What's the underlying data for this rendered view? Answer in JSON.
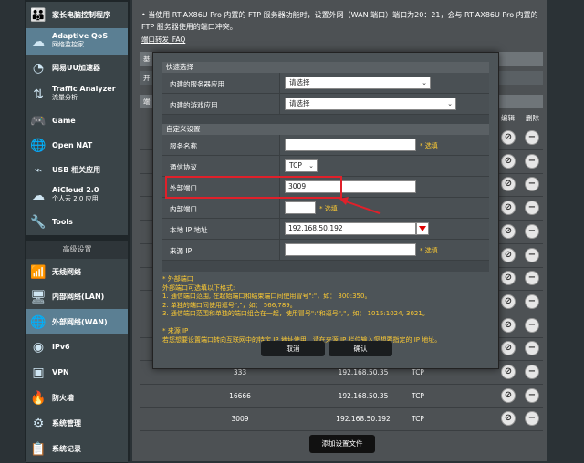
{
  "sidebar": {
    "items": [
      {
        "icon": "parental-control-icon",
        "label": "家长电脑控制程序",
        "sub": ""
      },
      {
        "icon": "qos-icon",
        "label": "Adaptive QoS",
        "sub": "网络监控家"
      },
      {
        "icon": "speedometer-icon",
        "label": "网易UU加速器",
        "sub": ""
      },
      {
        "icon": "traffic-icon",
        "label": "Traffic Analyzer",
        "sub": "流量分析"
      },
      {
        "icon": "gamepad-icon",
        "label": "Game",
        "sub": ""
      },
      {
        "icon": "globe-icon",
        "label": "Open NAT",
        "sub": ""
      },
      {
        "icon": "usb-icon",
        "label": "USB 相关应用",
        "sub": ""
      },
      {
        "icon": "cloud-icon",
        "label": "AiCloud 2.0",
        "sub": "个人云 2.0 应用"
      },
      {
        "icon": "wrench-icon",
        "label": "Tools",
        "sub": ""
      }
    ],
    "section_title": "高级设置",
    "advanced_items": [
      {
        "icon": "wifi-icon",
        "label": "无线网络"
      },
      {
        "icon": "lan-icon",
        "label": "内部网络(LAN)"
      },
      {
        "icon": "wan-icon",
        "label": "外部网络(WAN)"
      },
      {
        "icon": "ipv6-icon",
        "label": "IPv6"
      },
      {
        "icon": "vpn-icon",
        "label": "VPN"
      },
      {
        "icon": "firewall-icon",
        "label": "防火墙"
      },
      {
        "icon": "gear-icon",
        "label": "系统管理"
      },
      {
        "icon": "log-icon",
        "label": "系统记录"
      }
    ]
  },
  "main": {
    "note": "当使用 RT-AX86U Pro 内置的 FTP 服务器功能时，设置外网（WAN 端口）端口为20：21，会与 RT-AX86U Pro 内置的 FTP 服务器使用的端口冲突。",
    "faq_link": "端口转发_FAQ",
    "band1_text": "基",
    "band2_text": "开",
    "band3_text": "端",
    "col_edit": "编辑",
    "col_delete": "删除",
    "rows": [
      {
        "port": "",
        "ip": "",
        "proto": ""
      },
      {
        "port": "",
        "ip": "",
        "proto": ""
      },
      {
        "port": "",
        "ip": "",
        "proto": ""
      },
      {
        "port": "",
        "ip": "",
        "proto": ""
      },
      {
        "port": "",
        "ip": "",
        "proto": ""
      },
      {
        "port": "",
        "ip": "",
        "proto": ""
      },
      {
        "port": "",
        "ip": "",
        "proto": ""
      },
      {
        "port": "",
        "ip": "",
        "proto": ""
      },
      {
        "port": "",
        "ip": "",
        "proto": ""
      },
      {
        "port": "",
        "ip": "",
        "proto": ""
      },
      {
        "port": "333",
        "ip": "192.168.50.35",
        "proto": "TCP"
      },
      {
        "port": "16666",
        "ip": "192.168.50.35",
        "proto": "TCP"
      },
      {
        "port": "3009",
        "ip": "192.168.50.192",
        "proto": "TCP"
      }
    ],
    "add_button": "添加设置文件"
  },
  "modal": {
    "quick_title": "快速选择",
    "builtin_service_label": "内建的服务器应用",
    "builtin_service_value": "请选择",
    "builtin_game_label": "内建的游戏应用",
    "builtin_game_value": "请选择",
    "custom_title": "自定义设置",
    "service_name_label": "服务名称",
    "service_name_value": "",
    "required_text": "* 选填",
    "protocol_label": "通信协议",
    "protocol_value": "TCP",
    "external_port_label": "外部端口",
    "external_port_value": "3009",
    "internal_port_label": "内部端口",
    "internal_port_value": "",
    "local_ip_label": "本地 IP 地址",
    "local_ip_value": "192.168.50.192",
    "source_ip_label": "来源 IP",
    "source_ip_value": "",
    "notes": [
      "* 外部端口",
      "外部端口可选填以下格式:",
      "1. 通信端口范围, 在起始端口和结束端口间使用冒号\":\"，如：  300:350。",
      "2. 单独的端口间使用逗号\",\"，如：  566,789。",
      "3. 通信端口范围和单独的端口组合在一起，使用冒号\":\"和逗号\",\"，如：  1015:1024, 3021。",
      "",
      "* 来源 IP",
      "若您想要设置端口转向互联网中的特定 IP 地址使用，请在来源 IP 栏位输入您想要指定的 IP 地址。"
    ],
    "cancel_button": "取消",
    "ok_button": "确认"
  },
  "colors": {
    "highlight": "#e0202a",
    "note_text": "#ffcc33",
    "active_nav": "#5b7f93"
  }
}
